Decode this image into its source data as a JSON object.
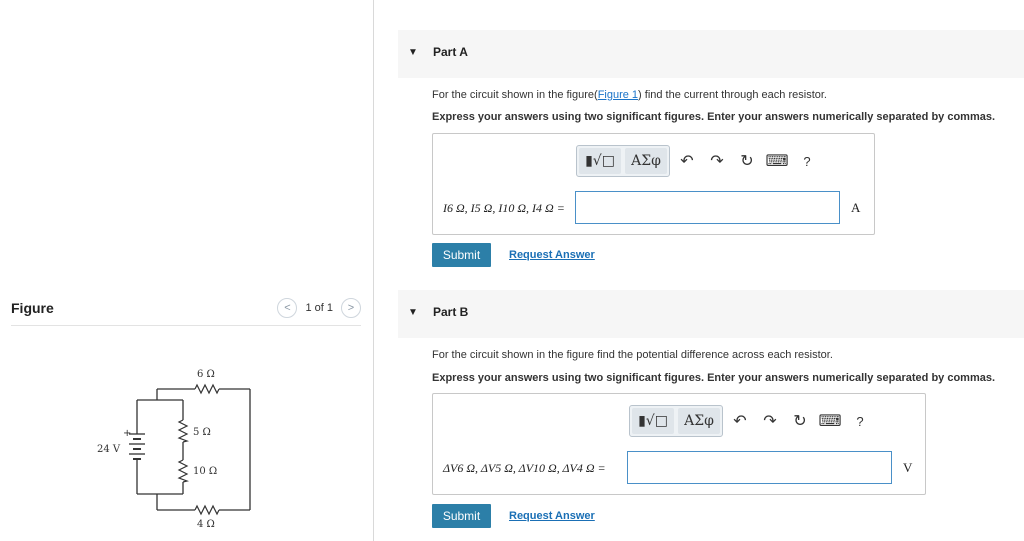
{
  "figure": {
    "title": "Figure",
    "pager_text": "1 of 1",
    "prev_symbol": "<",
    "next_symbol": ">",
    "circuit": {
      "r_top": "6 Ω",
      "r_mid_upper": "5 Ω",
      "r_mid_lower": "10 Ω",
      "r_bottom": "4 Ω",
      "battery": "24 V",
      "plus": "+",
      "minus": "−"
    }
  },
  "part_a": {
    "title": "Part A",
    "question_prefix": "For the circuit shown in the figure(",
    "question_link": "Figure 1",
    "question_suffix": ") find the current through each resistor.",
    "instruction": "Express your answers using two significant figures. Enter your answers numerically separated by commas.",
    "equation_label": "I6 Ω, I5 Ω, I10 Ω, I4 Ω =",
    "input_value": "",
    "unit": "A",
    "submit_label": "Submit",
    "request_label": "Request Answer"
  },
  "part_b": {
    "title": "Part B",
    "question": "For the circuit shown in the figure find the potential difference across each resistor.",
    "instruction": "Express your answers using two significant figures. Enter your answers numerically separated by commas.",
    "equation_label": "ΔV6 Ω, ΔV5 Ω, ΔV10 Ω, ΔV4 Ω =",
    "input_value": "",
    "unit": "V",
    "submit_label": "Submit",
    "request_label": "Request Answer"
  },
  "toolbar": {
    "templates_label": "▮√□",
    "symbols_label": "ΑΣφ",
    "undo": "↶",
    "redo": "↷",
    "reset": "↻",
    "keyboard": "⌨",
    "help": "?"
  },
  "collapse_symbol": "▼",
  "colors": {
    "submit_bg": "#2c7fa8",
    "link": "#1a6fb5",
    "input_border": "#4a90c8"
  }
}
